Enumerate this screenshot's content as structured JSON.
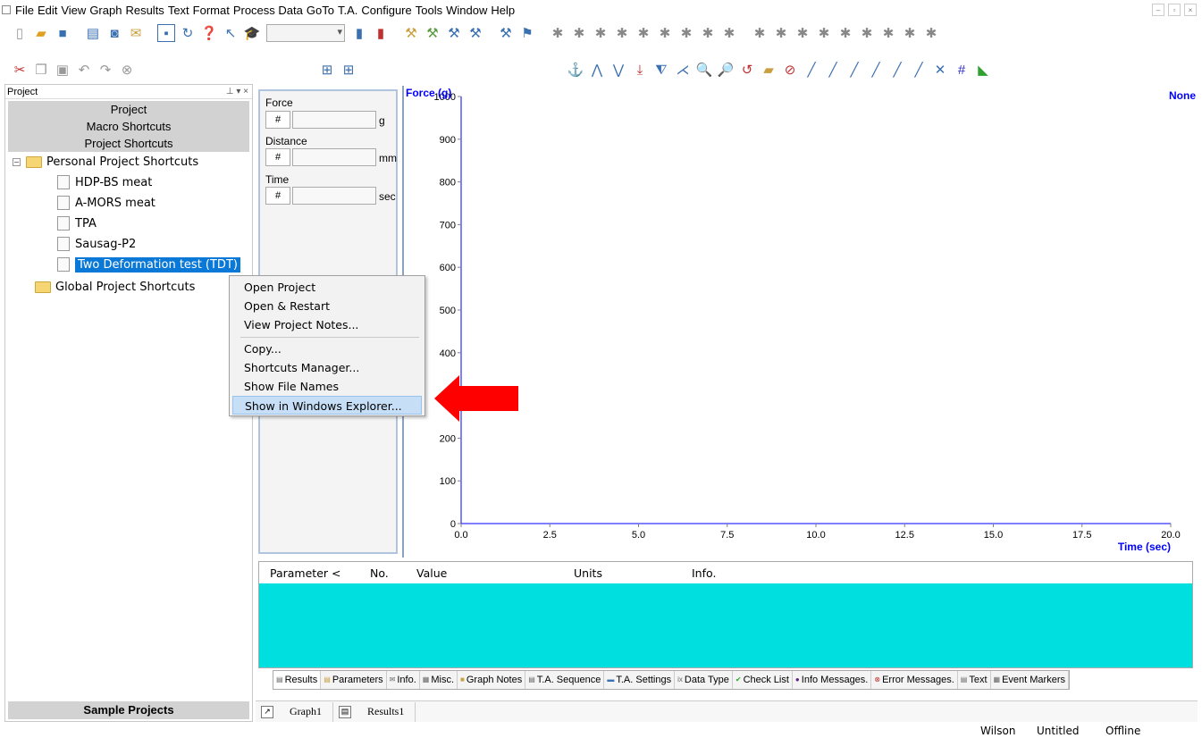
{
  "menubar": {
    "items": [
      "File",
      "Edit",
      "View",
      "Graph",
      "Results",
      "Text",
      "Format",
      "Process Data",
      "GoTo",
      "T.A.",
      "Configure",
      "Tools",
      "Window",
      "Help"
    ]
  },
  "project_pane": {
    "title": "Project",
    "header_buttons": [
      "Project",
      "Macro Shortcuts",
      "Project Shortcuts"
    ],
    "personal_folder": "Personal Project Shortcuts",
    "personal_items": [
      "HDP-BS  meat",
      "A-MORS  meat",
      "TPA",
      "Sausag-P2",
      "Two Deformation test (TDT)"
    ],
    "global_folder": "Global Project Shortcuts",
    "sample_button": "Sample Projects"
  },
  "readout": {
    "fields": [
      {
        "label": "Force",
        "hash": "#",
        "unit": "g"
      },
      {
        "label": "Distance",
        "hash": "#",
        "unit": "mm"
      },
      {
        "label": "Time",
        "hash": "#",
        "unit": "sec"
      }
    ]
  },
  "context_menu": {
    "items": [
      "Open Project",
      "Open & Restart",
      "View Project Notes...",
      "Copy...",
      "Shortcuts Manager...",
      "Show File Names",
      "Show in Windows Explorer..."
    ],
    "highlighted_index": 6
  },
  "chart_data": {
    "type": "line",
    "title": "",
    "ylabel": "Force (g)",
    "xlabel": "Time (sec)",
    "corner_label": "None",
    "xlim": [
      0,
      20
    ],
    "ylim": [
      0,
      1000
    ],
    "x_ticks": [
      "0.0",
      "2.5",
      "5.0",
      "7.5",
      "10.0",
      "12.5",
      "15.0",
      "17.5",
      "20.0"
    ],
    "y_ticks": [
      "0",
      "100",
      "200",
      "",
      "400",
      "500",
      "600",
      "700",
      "800",
      "900",
      "1000"
    ],
    "series": [],
    "axis_color": "#0000ff"
  },
  "results_table": {
    "columns": [
      "Parameter <",
      "No.",
      "Value",
      "Units",
      "Info."
    ],
    "body_color": "#00dfe0"
  },
  "result_tabs": [
    "Results",
    "Parameters",
    "Info.",
    "Misc.",
    "Graph Notes",
    "T.A. Sequence",
    "T.A. Settings",
    "Data Type",
    "Check List",
    "Info Messages.",
    "Error Messages.",
    "Text",
    "Event Markers"
  ],
  "doc_tabs": [
    "Graph1",
    "Results1"
  ],
  "status": {
    "user": "Wilson",
    "file": "Untitled",
    "connection": "Offline"
  }
}
